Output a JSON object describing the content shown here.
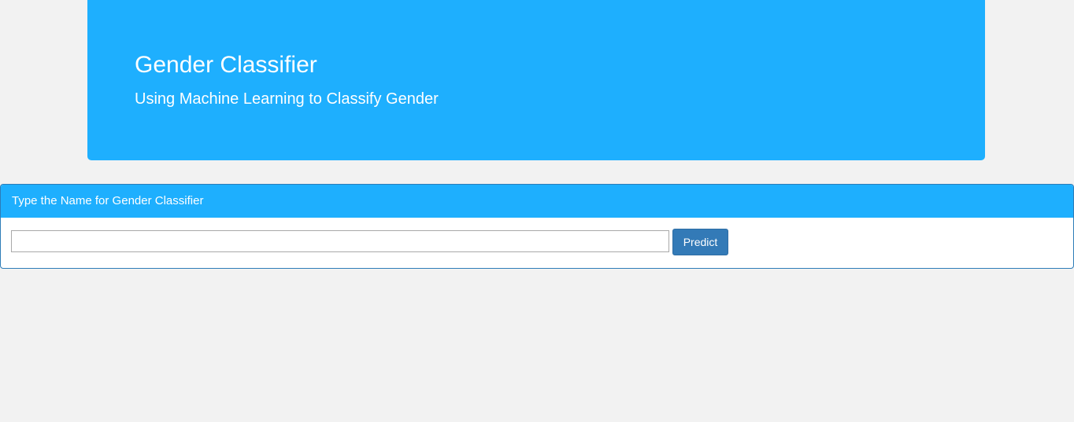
{
  "header": {
    "title": "Gender Classifier",
    "subtitle": "Using Machine Learning to Classify Gender"
  },
  "form_panel": {
    "heading": "Type the Name for Gender Classifier",
    "name_input": {
      "value": "",
      "placeholder": ""
    },
    "predict_label": "Predict"
  },
  "colors": {
    "accent": "#1eaffe",
    "button": "#337ab7",
    "background": "#f2f2f2"
  }
}
